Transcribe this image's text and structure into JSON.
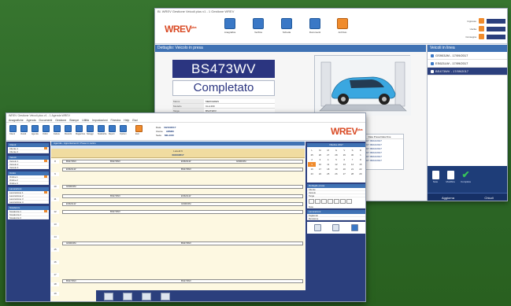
{
  "back_window": {
    "title_bar": "Bl. WREV Gestione Veicoli plus v1 - 1 Gestione WREV",
    "logo_main": "WREV",
    "logo_suffix": "plus",
    "section_title": "Dettaglio: Veicolo in presa",
    "plate": "BS473WV",
    "status": "Completato",
    "details": [
      {
        "k": "Marca",
        "v": "MERCEDES"
      },
      {
        "k": "Modello",
        "v": "CLA 200"
      },
      {
        "k": "Targa",
        "v": "BS473WV"
      },
      {
        "k": "Telaio",
        "v": "WDD1173431N"
      },
      {
        "k": "Cliente",
        "v": "Rossi Mario"
      },
      {
        "k": "Km",
        "v": "45210"
      }
    ],
    "ribbon_buttons": [
      "Anagrafica",
      "Verifica",
      "Scheda",
      "Documenti",
      "Archivio"
    ],
    "right_controls": [
      {
        "label": "Ingresso"
      },
      {
        "label": "Uscita"
      },
      {
        "label": "Consegna"
      }
    ],
    "calendar_list": {
      "header": "Data Presa   Data Fine",
      "rows": [
        "09/10/2017  09/10/2017",
        "09/10/2017  09/10/2017",
        "09/10/2017  09/10/2017",
        "09/10/2017  09/10/2017",
        "09/10/2017  09/10/2017",
        "09/10/2017  09/10/2017"
      ]
    },
    "sidebar": {
      "title": "Veicoli in linea",
      "items": [
        {
          "label": "GS903JM - 17/09/2017",
          "selected": false
        },
        {
          "label": "ES621LW - 17/09/2017",
          "selected": false
        },
        {
          "label": "BS473WV - 17/09/2017",
          "selected": true
        }
      ],
      "tools": [
        "Note",
        "Modifica",
        "Completa"
      ],
      "buttons": [
        "Aggiorna",
        "Chiudi"
      ]
    }
  },
  "front_window": {
    "title_bar": "WREV Gestione Veicoli plus v1 - 1 Agenda WREV",
    "menu": "Anagrafiche  Agenda  Documenti  Gestione  Stampe  Utilità  Impostazioni  Finestra  Help  Esci",
    "logo_main": "WREV",
    "logo_suffix": "plus",
    "info": [
      {
        "k": "Data",
        "v": "09/10/2017"
      },
      {
        "k": "Utente",
        "v": "ADMIN"
      },
      {
        "k": "Sede",
        "v": "MILANO"
      }
    ],
    "toolbar_buttons": [
      "Clienti",
      "Veicoli",
      "Agenda",
      "Ordini",
      "Fatture",
      "Ricambi",
      "Magazzino",
      "Noleggi",
      "Statistiche",
      "Report",
      "Opzioni",
      "Esci"
    ],
    "left_groups": [
      {
        "title": "Clienti",
        "items": [
          "Cliente 1",
          "Cliente 2"
        ]
      },
      {
        "title": "Veicoli",
        "items": [
          "Veicolo 1",
          "Veicolo 2",
          "Veicolo 3"
        ]
      },
      {
        "title": "Ordini",
        "items": [
          "Ordine 1",
          "Ordine 2",
          "Ordine 3"
        ]
      },
      {
        "title": "Lavorazioni",
        "items": [
          "Lavorazione 1",
          "Lavorazione 2",
          "Lavorazione 3",
          "Lavorazione 4"
        ]
      },
      {
        "title": "Scadenze",
        "items": [
          "Scadenza 1",
          "Scadenza 2",
          "Scadenza 3"
        ]
      }
    ],
    "center_header": "Agenda - Appuntamenti / Prese in carico",
    "day_head": {
      "line1": "Lunedì 9",
      "line2": "09/10/2017"
    },
    "hours": [
      "8",
      "9",
      "10",
      "11",
      "12",
      "13",
      "14",
      "15",
      "16",
      "17",
      "18",
      "19"
    ],
    "appointments": [
      {
        "a": "BS473WV",
        "b": "BS473WV",
        "c": "ES621LW",
        "d": "GS903JM"
      },
      {
        "a": "ES621LW",
        "b": "",
        "c": "BS473WV",
        "d": ""
      },
      {
        "a": "GS903JM",
        "b": "",
        "c": "",
        "d": ""
      },
      {
        "a": "",
        "b": "BS473WV",
        "c": "ES621LW",
        "d": ""
      },
      {
        "a": "ES621LW",
        "b": "",
        "c": "GS903JM",
        "d": ""
      },
      {
        "a": "",
        "b": "BS473WV",
        "c": "",
        "d": ""
      },
      {
        "a": "GS903JM",
        "b": "",
        "c": "BS473WV",
        "d": ""
      },
      {
        "a": "BS473WV",
        "b": "",
        "c": "BS473WV",
        "d": ""
      }
    ],
    "calendar": {
      "month": "Ottobre 2017",
      "days": [
        "L",
        "M",
        "M",
        "G",
        "V",
        "S",
        "D",
        "25",
        "26",
        "27",
        "28",
        "29",
        "30",
        "1",
        "2",
        "3",
        "4",
        "5",
        "6",
        "7",
        "8",
        "9",
        "10",
        "11",
        "12",
        "13",
        "14",
        "15",
        "16",
        "17",
        "18",
        "19",
        "20",
        "21",
        "22",
        "23",
        "24",
        "25",
        "26",
        "27",
        "28",
        "29"
      ],
      "today": "9"
    },
    "right_panel": {
      "title": "Dettaglio presa",
      "fields": [
        "Cliente",
        "Veicolo",
        "Targa",
        "Note"
      ],
      "title2": "Lavorazioni",
      "fields2": [
        "Tagliando",
        "Revisione"
      ]
    }
  }
}
